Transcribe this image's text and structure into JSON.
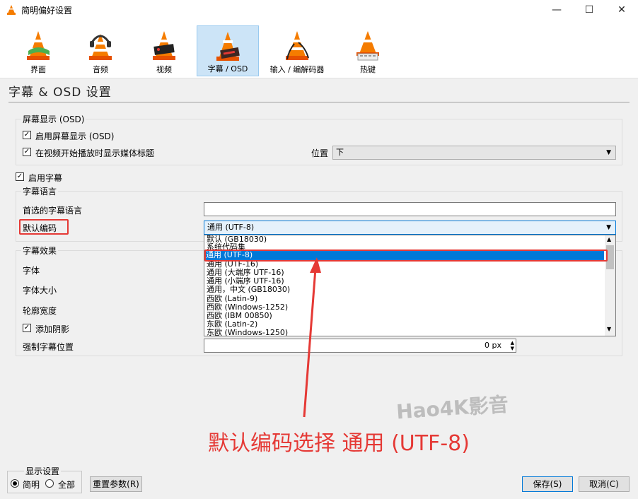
{
  "window": {
    "title": "简明偏好设置",
    "minimize": "—",
    "maximize": "☐",
    "close": "✕"
  },
  "toolbar": {
    "items": [
      {
        "label": "界面",
        "active": false
      },
      {
        "label": "音频",
        "active": false
      },
      {
        "label": "视频",
        "active": false
      },
      {
        "label": "字幕 / OSD",
        "active": true
      },
      {
        "label": "输入 / 编解码器",
        "active": false
      },
      {
        "label": "热键",
        "active": false
      }
    ]
  },
  "page_title": "字幕 & OSD 设置",
  "osd": {
    "group_label": "屏幕显示 (OSD)",
    "enable_osd": {
      "label": "启用屏幕显示 (OSD)",
      "checked": true
    },
    "show_title": {
      "label": "在视频开始播放时显示媒体标题",
      "checked": true
    },
    "position_label": "位置",
    "position_value": "下"
  },
  "subtitles": {
    "enable": {
      "label": "启用字幕",
      "checked": true
    },
    "language_group_label": "字幕语言",
    "preferred_lang_label": "首选的字幕语言",
    "preferred_lang_value": "",
    "default_encoding_label": "默认编码",
    "default_encoding_value": "通用 (UTF-8)",
    "encoding_options": [
      "默认 (GB18030)",
      "系统代码集",
      "通用 (UTF-8)",
      "通用 (UTF-16)",
      "通用 (大端序 UTF-16)",
      "通用 (小端序 UTF-16)",
      "通用，中文 (GB18030)",
      "西欧 (Latin-9)",
      "西欧 (Windows-1252)",
      "西欧 (IBM 00850)",
      "东欧 (Latin-2)",
      "东欧 (Windows-1250)"
    ],
    "selected_index": 2,
    "effects_group_label": "字幕效果",
    "font_label": "字体",
    "font_size_label": "字体大小",
    "outline_label": "轮廓宽度",
    "shadow": {
      "label": "添加阴影",
      "checked": true
    },
    "force_pos_label": "强制字幕位置",
    "force_pos_value": "0 px"
  },
  "display_settings": {
    "group_label": "显示设置",
    "simple_label": "简明",
    "all_label": "全部",
    "selected": "simple"
  },
  "buttons": {
    "reset": "重置参数(R)",
    "save": "保存(S)",
    "cancel": "取消(C)"
  },
  "annotation": {
    "text": "默认编码选择 通用 (UTF-8)",
    "color": "#e53935"
  },
  "watermark": "Hao4K影音",
  "colors": {
    "accent": "#0078d7",
    "cone_orange": "#f57c00"
  }
}
